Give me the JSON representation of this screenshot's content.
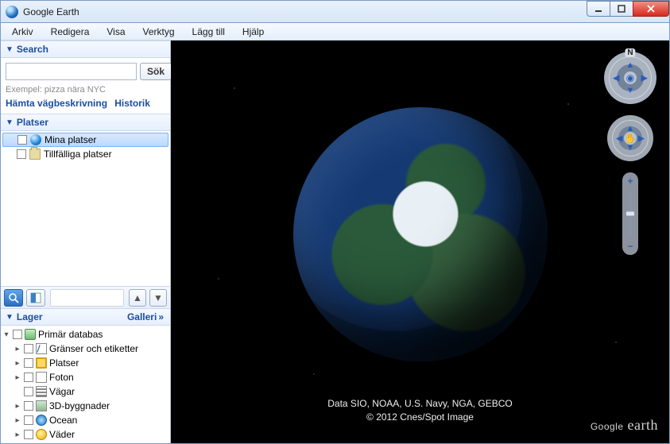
{
  "window": {
    "title": "Google Earth"
  },
  "menu": {
    "items": [
      "Arkiv",
      "Redigera",
      "Visa",
      "Verktyg",
      "Lägg till",
      "Hjälp"
    ]
  },
  "search": {
    "title": "Search",
    "button": "Sök",
    "hint": "Exempel: pizza nära NYC",
    "link_directions": "Hämta vägbeskrivning",
    "link_history": "Historik"
  },
  "places": {
    "title": "Platser",
    "items": [
      {
        "label": "Mina platser",
        "selected": true,
        "icon": "globe"
      },
      {
        "label": "Tillfälliga platser",
        "selected": false,
        "icon": "folder"
      }
    ]
  },
  "layers": {
    "title": "Lager",
    "gallery": "Galleri",
    "items": [
      {
        "label": "Primär databas",
        "twisty": "▾",
        "indent": 0,
        "icon": "db"
      },
      {
        "label": "Gränser och etiketter",
        "twisty": "▸",
        "indent": 1,
        "icon": "borders"
      },
      {
        "label": "Platser",
        "twisty": "▸",
        "indent": 1,
        "icon": "places"
      },
      {
        "label": "Foton",
        "twisty": "▸",
        "indent": 1,
        "icon": "photos"
      },
      {
        "label": "Vägar",
        "twisty": "",
        "indent": 1,
        "icon": "roads"
      },
      {
        "label": "3D-byggnader",
        "twisty": "▸",
        "indent": 1,
        "icon": "buildings"
      },
      {
        "label": "Ocean",
        "twisty": "▸",
        "indent": 1,
        "icon": "ocean"
      },
      {
        "label": "Väder",
        "twisty": "▸",
        "indent": 1,
        "icon": "weather"
      }
    ]
  },
  "viewport": {
    "attrib1": "Data SIO, NOAA, U.S. Navy, NGA, GEBCO",
    "attrib2": "© 2012 Cnes/Spot Image",
    "brand": "Google earth"
  },
  "nav": {
    "north": "N",
    "zoom_in": "+",
    "zoom_out": "−"
  }
}
